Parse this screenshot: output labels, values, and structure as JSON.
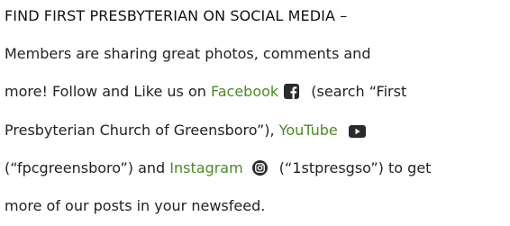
{
  "heading": "FIND FIRST PRESBYTERIAN ON SOCIAL MEDIA –",
  "colors": {
    "link": "#4a8a23",
    "text": "#222222",
    "icon": "#2b2b2b"
  },
  "paragraph": {
    "line1": "Members are sharing great photos, comments and",
    "line2": "more! Follow and Like us on",
    "facebook_link": "Facebook",
    "facebook_icon": "facebook-icon",
    "line3_tail": "(search “First",
    "line4_head": "Presbyterian Church of Greensboro”),",
    "youtube_link": "YouTube",
    "youtube_icon": "youtube-icon",
    "line5_head": "(“fpcgreensboro”) and",
    "instagram_link": "Instagram",
    "instagram_icon": "instagram-icon",
    "line5_tail": "(“1stpresgso”) to get",
    "line6": "more of our posts in your newsfeed."
  }
}
